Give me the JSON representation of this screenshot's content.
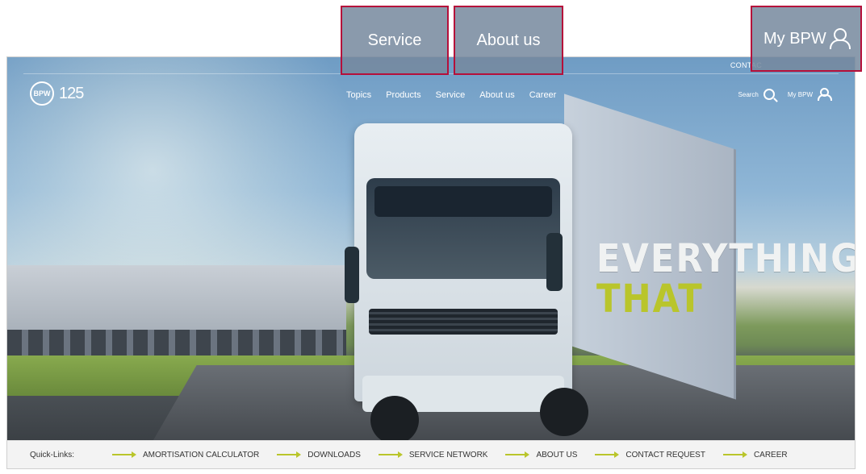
{
  "header": {
    "contact_label": "CONTAC",
    "logo_text": "125",
    "nav": [
      "Topics",
      "Products",
      "Service",
      "About us",
      "Career"
    ],
    "search_label": "Search",
    "account_label": "My BPW"
  },
  "hero": {
    "headline_line1": "EVERYTHING",
    "headline_line2": "THAT"
  },
  "callouts": {
    "service": "Service",
    "about": "About us",
    "mybpw": "My BPW"
  },
  "quick_links": {
    "label": "Quick-Links:",
    "items": [
      "AMORTISATION CALCULATOR",
      "DOWNLOADS",
      "SERVICE NETWORK",
      "ABOUT US",
      "CONTACT REQUEST",
      "CAREER"
    ]
  },
  "colors": {
    "accent": "#b9c52b",
    "callout_border": "#b50f3a"
  }
}
